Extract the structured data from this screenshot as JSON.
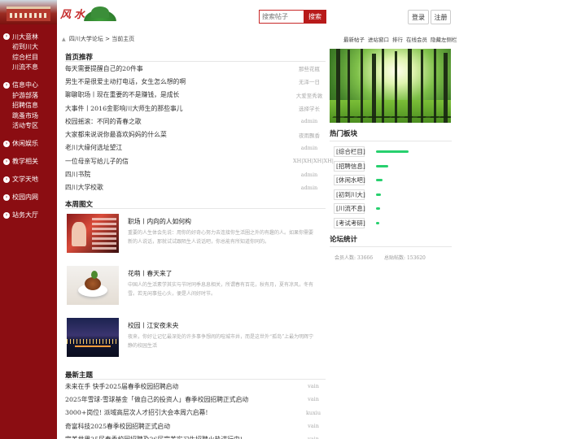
{
  "sidebar": {
    "sections": [
      {
        "title": "川大意林",
        "items": [
          "初到川大",
          "综合栏目",
          "川流不息"
        ]
      },
      {
        "title": "信息中心",
        "items": [
          "护游部落",
          "招聘信息",
          "跳蚤市场",
          "活动专区"
        ]
      },
      {
        "title": "休闲娱乐",
        "items": []
      },
      {
        "title": "教学相关",
        "items": []
      },
      {
        "title": "文学天地",
        "items": []
      },
      {
        "title": "校园内网",
        "items": []
      },
      {
        "title": "站务大厅",
        "items": []
      }
    ]
  },
  "header": {
    "brand_text": "风水",
    "search_placeholder": "搜索帖子",
    "search_button": "搜索",
    "login": "登录",
    "register": "注册"
  },
  "breadcrumb": {
    "site": "四川大学论坛",
    "separator": ">",
    "current": "当前主页"
  },
  "toplinks": [
    "最新帖子",
    "进站窗口",
    "排行",
    "在线会员",
    "隐藏左侧栏"
  ],
  "featured": {
    "title": "首页推荐",
    "rows": [
      {
        "title": "每天需要提醒自己的20件事",
        "author": "那些花瓶"
      },
      {
        "title": "男生不是很爱主动打电话，女生怎么想的啊",
        "author": "无泽一日"
      },
      {
        "title": "聊聊职场丨现在重要的不是赚钱，是成长",
        "author": "大爱至秀敦"
      },
      {
        "title": "大事件丨2016金影响川大师生的那些事儿",
        "author": "选择学长"
      },
      {
        "title": "校园摇滚：不同的青春之歌",
        "author": "admin"
      },
      {
        "title": "大家都来说说你最喜欢妈妈的什么菜",
        "author": "夜雨飘香"
      },
      {
        "title": "老川大缘何选址望江",
        "author": "admin"
      },
      {
        "title": "一位母亲写给儿子的信",
        "author": "XH|XH|XH|XH|"
      },
      {
        "title": "四川书院",
        "author": "admin"
      },
      {
        "title": "四川大学校歌",
        "author": "admin"
      }
    ]
  },
  "weekly": {
    "title": "本周图文",
    "items": [
      {
        "title": "职场丨内向的人如何构",
        "desc": "重要的人生体会先说：用你的好奇心努力去连接你生活圈之外的有趣的人。如果你需要新的人说话，那就试试跟陌生人说话吧，你总能有所知道你同的。"
      },
      {
        "title": "花萌丨春天来了",
        "desc": "中国人的生活素学其实与节时同季息息相关，所谓春有百花，秋有月，夏有凉风，冬有雪。若无闲事挂心头，便是人间好时节。"
      },
      {
        "title": "校园丨江安夜未央",
        "desc": "夜来，你好让记忆最深处的许多事争想闹的喧城市井，而是这世外“孤岛”上最为明辉宁静的校园生活"
      }
    ]
  },
  "latest": {
    "title": "最新主题",
    "rows": [
      {
        "title": "未来在手 快手2025届春季校园招聘启动",
        "author": "vain"
      },
      {
        "title": "2025年雪球-雪球基金「做自己的投资人」春季校园招聘正式启动",
        "author": "vain"
      },
      {
        "title": "3000+岗位! 派域高层次人才招引大会本周六启幕!",
        "author": "kuxiu"
      },
      {
        "title": "奇富科技2025春季校园招聘正式启动",
        "author": "vain"
      },
      {
        "title": "完美世界25届春季校园招聘及26届完美实习生招聘火热进行中!",
        "author": "vain"
      }
    ]
  },
  "hot": {
    "title": "热门板块",
    "boards": [
      {
        "name": "[综合栏目]",
        "level": 1.0
      },
      {
        "name": "[招聘信息]",
        "level": 0.37
      },
      {
        "name": "[休闲水吧]",
        "level": 0.2
      },
      {
        "name": "[初到川大]",
        "level": 0.15
      },
      {
        "name": "[川流不息]",
        "level": 0.12
      },
      {
        "name": "[考试考研]",
        "level": 0.08
      }
    ]
  },
  "stats": {
    "title": "论坛统计",
    "members": "会员人数: 33666",
    "posts": "总贴帖数: 153620"
  },
  "colors": {
    "sidebar_bg": "#8b0d12",
    "search_red": "#b81a1a",
    "bar_green": "#27d06e"
  }
}
